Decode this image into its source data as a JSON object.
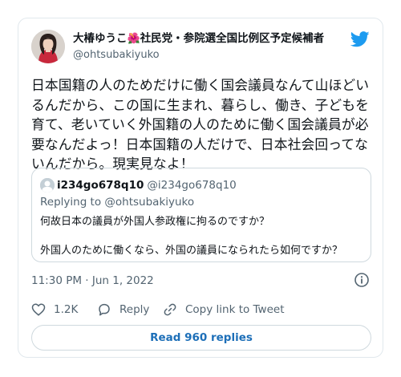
{
  "author": {
    "name_prefix": "大椿ゆうこ",
    "name_flower": "🌺",
    "name_suffix": "社民党・参院選全国比例区予定候補者",
    "handle": "@ohtsubakiyuko"
  },
  "tweet": {
    "text": "日本国籍の人のためだけに働く国会議員なんて山ほどいるんだから、この国に生まれ、暮らし、働き、子どもを育て、老いていく外国籍の人のために働く国会議員が必要なんだよっ！日本国籍の人だけで、日本社会回ってないんだから。現実見なよ！",
    "timestamp": "11:30 PM · Jun 1, 2022"
  },
  "quoted": {
    "name": "i234go678q10",
    "handle": "@i234go678q10",
    "replying_prefix": "Replying to ",
    "replying_to": "@ohtsubakiyuko",
    "line1": "何故日本の議員が外国人参政権に拘るのですか？",
    "line2": "外国人のために働くなら、外国の議員になられたら如何ですか？"
  },
  "actions": {
    "likes": "1.2K",
    "reply_label": "Reply",
    "copy_link_label": "Copy link to Tweet"
  },
  "replies_button": "Read 960 replies",
  "colors": {
    "twitter_blue": "#1d9bf0",
    "link_blue": "#1d6fb8",
    "muted": "#536471",
    "border": "#cfd9de"
  },
  "icons": {
    "brand": "twitter-bird-icon",
    "info": "info-icon",
    "like": "heart-icon",
    "reply": "reply-bubble-icon",
    "copy": "link-icon"
  }
}
